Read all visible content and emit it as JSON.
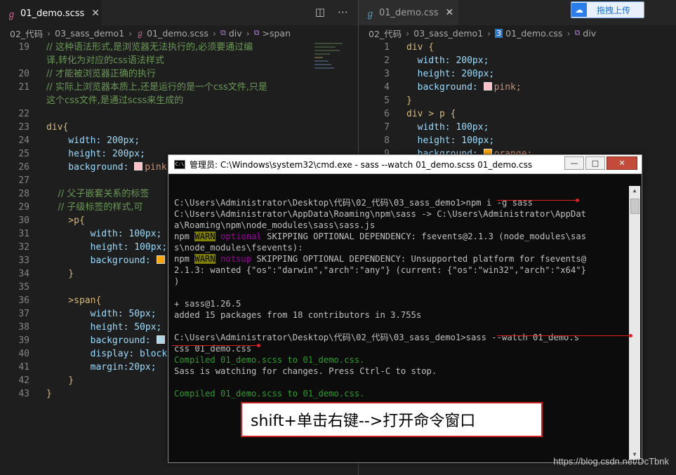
{
  "left_editor": {
    "tab": {
      "label": "01_demo.scss",
      "icon": "sass-file-icon"
    },
    "actions": [
      "split-editor-icon",
      "more-icon"
    ],
    "breadcrumb": [
      "02_代码",
      "03_sass_demo1",
      "01_demo.scss",
      "div",
      ">span"
    ],
    "lines": [
      {
        "n": "19",
        "cls": "c-comment",
        "text": "// 这种语法形式,是浏览器无法执行的,必须要通过编"
      },
      {
        "n": "",
        "cls": "c-comment",
        "text": "译,转化为对应的css语法样式"
      },
      {
        "n": "20",
        "cls": "c-comment",
        "text": "// 才能被浏览器正确的执行"
      },
      {
        "n": "21",
        "cls": "c-comment",
        "text": "// 实际上浏览器本质上,还是运行的是一个css文件,只是"
      },
      {
        "n": "",
        "cls": "c-comment",
        "text": "这个css文件,是通过scss来生成的"
      },
      {
        "n": "22",
        "cls": "",
        "text": ""
      },
      {
        "n": "23",
        "cls": "c-sel",
        "text": "div{"
      },
      {
        "n": "24",
        "cls": "c-prop",
        "text": "    width: 200px;"
      },
      {
        "n": "25",
        "cls": "c-prop",
        "text": "    height: 200px;"
      },
      {
        "n": "26",
        "cls": "c-prop",
        "text": "    background: ▢pink;"
      },
      {
        "n": "27",
        "cls": "",
        "text": ""
      },
      {
        "n": "28",
        "cls": "c-comment",
        "text": "    // 父子嵌套关系的标签"
      },
      {
        "n": "29",
        "cls": "c-comment",
        "text": "    // 子级标签的样式,可"
      },
      {
        "n": "30",
        "cls": "c-sel",
        "text": "    >p{"
      },
      {
        "n": "31",
        "cls": "c-prop",
        "text": "        width: 100px;"
      },
      {
        "n": "32",
        "cls": "c-prop",
        "text": "        height: 100px;"
      },
      {
        "n": "33",
        "cls": "c-prop",
        "text": "        background: ▢"
      },
      {
        "n": "34",
        "cls": "c-sel",
        "text": "    }"
      },
      {
        "n": "35",
        "cls": "",
        "text": ""
      },
      {
        "n": "36",
        "cls": "c-sel",
        "text": "    >span{"
      },
      {
        "n": "37",
        "cls": "c-prop",
        "text": "        width: 50px;"
      },
      {
        "n": "38",
        "cls": "c-prop",
        "text": "        height: 50px;"
      },
      {
        "n": "39",
        "cls": "c-prop",
        "text": "        background: ▢"
      },
      {
        "n": "40",
        "cls": "c-prop",
        "text": "        display: block"
      },
      {
        "n": "41",
        "cls": "c-prop",
        "text": "        margin:20px;"
      },
      {
        "n": "42",
        "cls": "c-sel",
        "text": "    }"
      },
      {
        "n": "43",
        "cls": "c-sel",
        "text": "}"
      }
    ]
  },
  "right_editor": {
    "tab": {
      "label": "01_demo.css",
      "icon": "css-file-icon"
    },
    "breadcrumb": [
      "02_代码",
      "03_sass_demo1",
      "01_demo.css",
      "div"
    ],
    "lines": [
      {
        "n": "1",
        "cls": "c-sel",
        "text": "div {"
      },
      {
        "n": "2",
        "cls": "c-prop",
        "text": "  width: 200px;"
      },
      {
        "n": "3",
        "cls": "c-prop",
        "text": "  height: 200px;"
      },
      {
        "n": "4",
        "cls": "c-prop",
        "text": "  background: ▢pink;"
      },
      {
        "n": "5",
        "cls": "c-sel",
        "text": "}"
      },
      {
        "n": "6",
        "cls": "c-sel",
        "text": "div > p {"
      },
      {
        "n": "7",
        "cls": "c-prop",
        "text": "  width: 100px;"
      },
      {
        "n": "8",
        "cls": "c-prop",
        "text": "  height: 100px;"
      },
      {
        "n": "9",
        "cls": "c-prop",
        "text": "  background: ▢orange;"
      }
    ]
  },
  "upload_button": {
    "label": "拖拽上传"
  },
  "cmd_window": {
    "title": "管理员: C:\\Windows\\system32\\cmd.exe - sass  --watch 01_demo.scss 01_demo.css",
    "buttons": [
      "—",
      "□",
      "✕"
    ],
    "lines": [
      {
        "type": "plain",
        "text": ""
      },
      {
        "type": "plain",
        "text": "C:\\Users\\Administrator\\Desktop\\代码\\02_代码\\03_sass_demo1>npm i -g sass"
      },
      {
        "type": "plain",
        "text": "C:\\Users\\Administrator\\AppData\\Roaming\\npm\\sass -> C:\\Users\\Administrator\\AppDat"
      },
      {
        "type": "plain",
        "text": "a\\Roaming\\npm\\node_modules\\sass\\sass.js"
      },
      {
        "type": "warn",
        "pre": "npm ",
        "warn": "WARN",
        "tag": " optional",
        "text": " SKIPPING OPTIONAL DEPENDENCY: fsevents@2.1.3 (node_modules\\sas"
      },
      {
        "type": "plain",
        "text": "s\\node_modules\\fsevents):"
      },
      {
        "type": "warn",
        "pre": "npm ",
        "warn": "WARN",
        "tag": " notsup",
        "text": " SKIPPING OPTIONAL DEPENDENCY: Unsupported platform for fsevents@"
      },
      {
        "type": "plain",
        "text": "2.1.3: wanted {\"os\":\"darwin\",\"arch\":\"any\"} (current: {\"os\":\"win32\",\"arch\":\"x64\"}"
      },
      {
        "type": "plain",
        "text": ")"
      },
      {
        "type": "plain",
        "text": ""
      },
      {
        "type": "plain",
        "text": "+ sass@1.26.5"
      },
      {
        "type": "plain",
        "text": "added 15 packages from 18 contributors in 3.755s"
      },
      {
        "type": "plain",
        "text": ""
      },
      {
        "type": "plain",
        "text": "C:\\Users\\Administrator\\Desktop\\代码\\02_代码\\03_sass_demo1>sass --watch 01_demo.s"
      },
      {
        "type": "plain",
        "text": "css 01_demo.css"
      },
      {
        "type": "green",
        "text": "Compiled 01_demo.scss to 01_demo.css."
      },
      {
        "type": "plain",
        "text": "Sass is watching for changes. Press Ctrl-C to stop."
      },
      {
        "type": "plain",
        "text": ""
      },
      {
        "type": "green",
        "text": "Compiled 01_demo.scss to 01_demo.css."
      }
    ]
  },
  "callout": {
    "text": "shift+单击右键-->打开命令窗口"
  },
  "watermark": {
    "text": "https://blog.csdn.net/DcTbnk"
  },
  "colors": {
    "pink": "#ffc0cb",
    "orange": "#ffa500",
    "lightblue": "#add8e6",
    "accent_red": "#d21f1f"
  }
}
